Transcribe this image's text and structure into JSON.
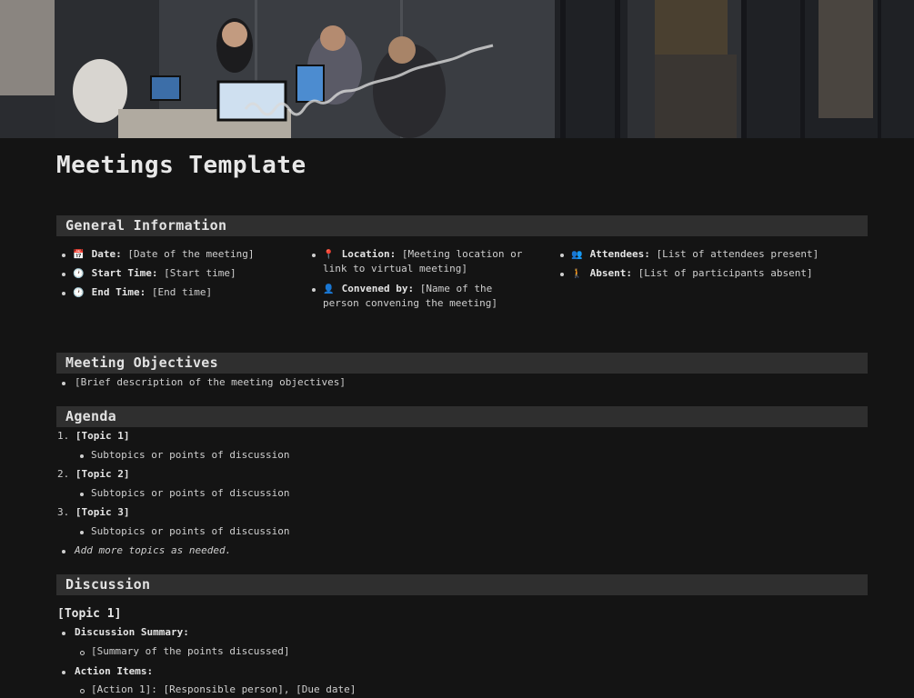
{
  "page": {
    "title": "Meetings Template"
  },
  "general": {
    "heading": "General Information",
    "col1": [
      {
        "icon": "calendar-icon",
        "glyph": "📅",
        "label": "Date:",
        "value": "[Date of the meeting]"
      },
      {
        "icon": "clock-icon",
        "glyph": "🕐",
        "label": "Start Time:",
        "value": "[Start time]"
      },
      {
        "icon": "clock-icon",
        "glyph": "🕐",
        "label": "End Time:",
        "value": "[End time]"
      }
    ],
    "col2": [
      {
        "icon": "pin-icon",
        "glyph": "📍",
        "label": "Location:",
        "value": "[Meeting location or",
        "value2": "link to virtual meeting]"
      },
      {
        "icon": "person-icon",
        "glyph": "👤",
        "label": "Convened by:",
        "value": "[Name of the",
        "value2": "person convening the meeting]"
      }
    ],
    "col3": [
      {
        "icon": "people-icon",
        "glyph": "👥",
        "label": "Attendees:",
        "value": "[List of attendees present]"
      },
      {
        "icon": "walking-icon",
        "glyph": "🚶",
        "label": "Absent:",
        "value": "[List of participants absent]"
      }
    ]
  },
  "objectives": {
    "heading": "Meeting Objectives",
    "items": [
      "[Brief description of the meeting objectives]"
    ]
  },
  "agenda": {
    "heading": "Agenda",
    "topics": [
      {
        "num": "1.",
        "label": "[Topic 1]",
        "sub": "Subtopics or points of discussion"
      },
      {
        "num": "2.",
        "label": "[Topic 2]",
        "sub": "Subtopics or points of discussion"
      },
      {
        "num": "3.",
        "label": "[Topic 3]",
        "sub": "Subtopics or points of discussion"
      }
    ],
    "more": "Add more topics as needed."
  },
  "discussion": {
    "heading": "Discussion",
    "topic": "[Topic 1]",
    "summary_label": "Discussion Summary:",
    "summary_value": "[Summary of the points discussed]",
    "action_label": "Action Items:",
    "action_value": "[Action 1]: [Responsible person], [Due date]"
  }
}
